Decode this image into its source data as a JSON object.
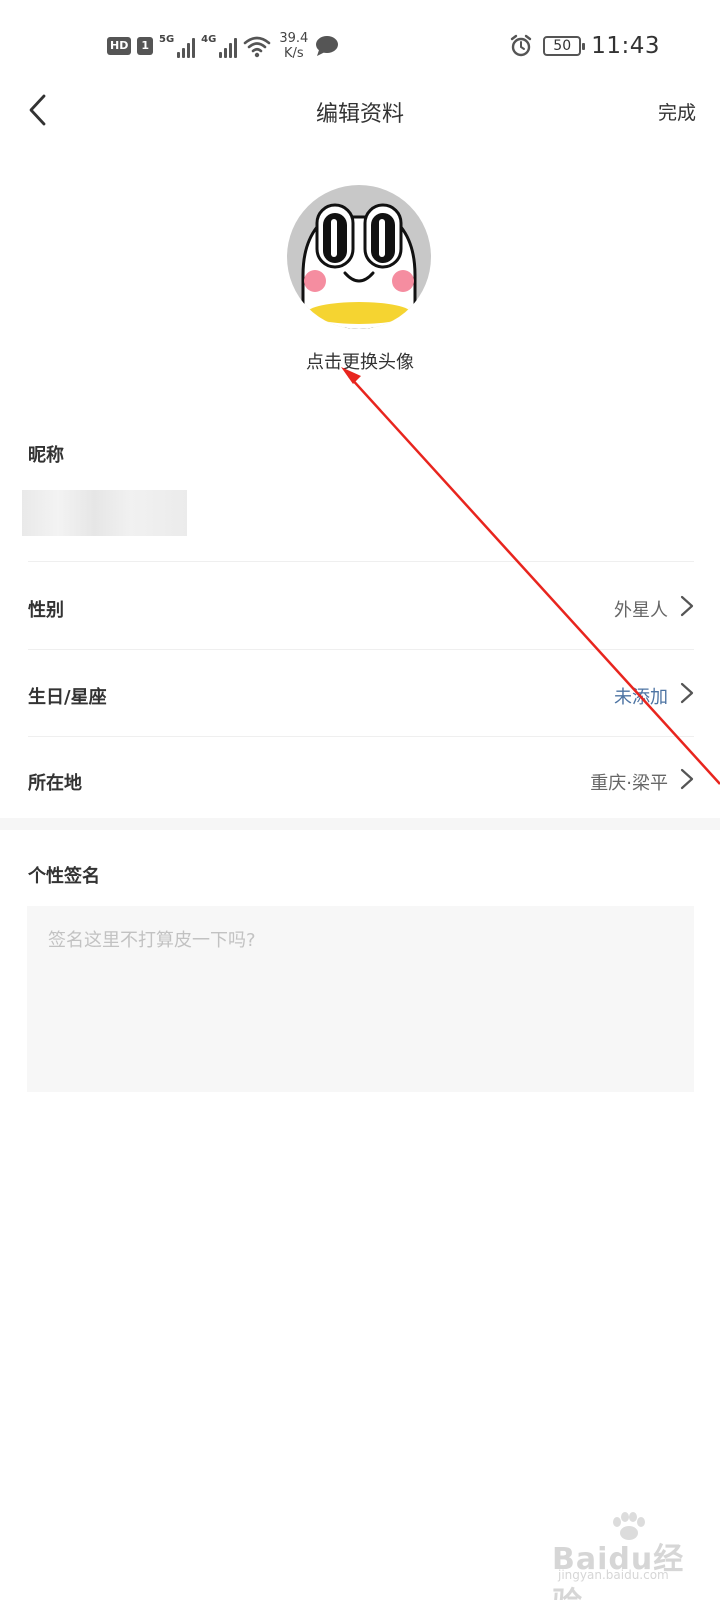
{
  "status_bar": {
    "hd_badge": "HD",
    "sim_badge": "1",
    "net1_label": "5G",
    "net2_label": "4G",
    "speed_value": "39.4",
    "speed_unit": "K/s",
    "battery_level": "50",
    "time": "11:43",
    "icons": [
      "signal-icon",
      "wifi-icon",
      "message-icon",
      "alarm-icon",
      "battery-icon"
    ]
  },
  "nav": {
    "title": "编辑资料",
    "done_label": "完成",
    "back_icon": "chevron-left-icon"
  },
  "avatar": {
    "caption": "点击更换头像"
  },
  "nickname": {
    "label": "昵称"
  },
  "rows": [
    {
      "label": "性别",
      "value": "外星人"
    },
    {
      "label": "生日/星座",
      "value": "未添加"
    },
    {
      "label": "所在地",
      "value": "重庆·梁平"
    }
  ],
  "signature": {
    "label": "个性签名",
    "placeholder": "签名这里不打算皮一下吗?"
  },
  "watermark": {
    "brand": "Baidu经验",
    "url": "jingyan.baidu.com"
  },
  "colors": {
    "accent_value": "#4d74a3",
    "annotation_arrow": "#e8251e"
  }
}
